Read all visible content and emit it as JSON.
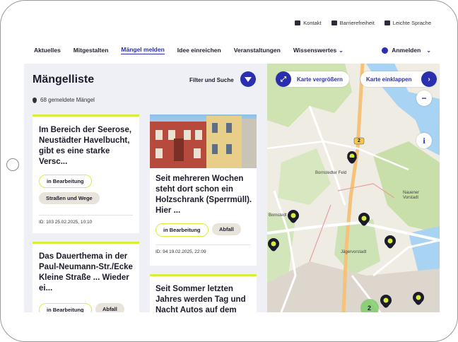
{
  "utility": {
    "contact": "Kontakt",
    "accessibility": "Barrierefreiheit",
    "easy_language": "Leichte Sprache"
  },
  "nav": {
    "items": [
      "Aktuelles",
      "Mitgestalten",
      "Mängel melden",
      "Idee einreichen",
      "Veranstaltungen",
      "Wissenswertes"
    ],
    "active": "Mängel melden",
    "login": "Anmelden"
  },
  "list": {
    "title": "Mängelliste",
    "filter_label": "Filter und Suche",
    "count": "68 gemeldete Mängel"
  },
  "cards": [
    {
      "text": "Im Bereich der Seerose, Neustädter Havelbucht, gibt es eine starke Versc...",
      "status": "in Bearbeitung",
      "category": "Straßen und Wege",
      "meta": "ID: 103   25.02.2025, 10:10"
    },
    {
      "text": "Seit mehreren Wochen steht dort schon ein Holzschrank (Sperrmüll). Hier ...",
      "status": "in Bearbeitung",
      "category": "Abfall",
      "meta": "ID: 94   19.02.2025, 22:09"
    },
    {
      "text": "Das Dauerthema in der Paul-Neumann-Str./Ecke Kleine Straße ... Wieder ei...",
      "status": "in Bearbeitung",
      "category": "Abfall"
    },
    {
      "text": "Seit Sommer letzten Jahres werden Tag und Nacht Autos auf dem"
    }
  ],
  "map": {
    "enlarge": "Karte vergrößern",
    "collapse": "Karte einklappen",
    "zoom_out": "−",
    "info": "i",
    "labels": [
      "Bornstedter Feld",
      "Nauener Vorstadt",
      "Jägervorstadt",
      "Bornstedt"
    ],
    "road_badge": "2",
    "cluster": "2",
    "colors": {
      "accent": "#2a2fb0",
      "marker": "#d7ef3c"
    }
  }
}
